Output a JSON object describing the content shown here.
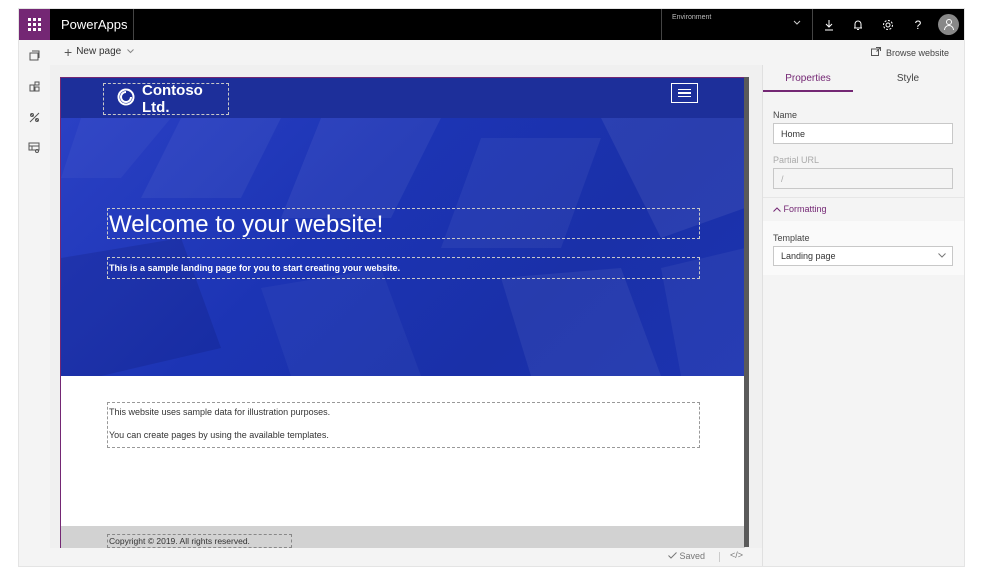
{
  "topbar": {
    "app_title": "PowerApps",
    "environment_label": "Environment",
    "icons": [
      "waffle-icon",
      "chevron-down-icon",
      "download-icon",
      "bell-icon",
      "gear-icon",
      "help-icon",
      "avatar-icon"
    ],
    "help_glyph": "?"
  },
  "leftrail": {
    "icons": [
      "pages-icon",
      "components-icon",
      "themes-icon",
      "templates-icon"
    ]
  },
  "cmdbar": {
    "new_page_label": "New page",
    "browse_label": "Browse website"
  },
  "site": {
    "logo_text": "Contoso Ltd.",
    "hero_title": "Welcome to your website!",
    "hero_subtitle": "This is a sample landing page for you to start creating your website.",
    "content_line1": "This website uses sample data for illustration purposes.",
    "content_line2": "You can create pages by using the available templates.",
    "copyright": "Copyright © 2019. All rights reserved."
  },
  "statusbar": {
    "saved_label": "Saved",
    "code_label": "</>"
  },
  "rightpanel": {
    "tabs": [
      "Properties",
      "Style"
    ],
    "active_tab": "Properties",
    "name_label": "Name",
    "name_value": "Home",
    "partial_url_label": "Partial URL",
    "partial_url_value": "/",
    "formatting_label": "Formatting",
    "template_label": "Template",
    "template_value": "Landing page"
  },
  "colors": {
    "brand": "#742774",
    "hero_blue": "#1d2f9a",
    "topbar": "#000000"
  }
}
